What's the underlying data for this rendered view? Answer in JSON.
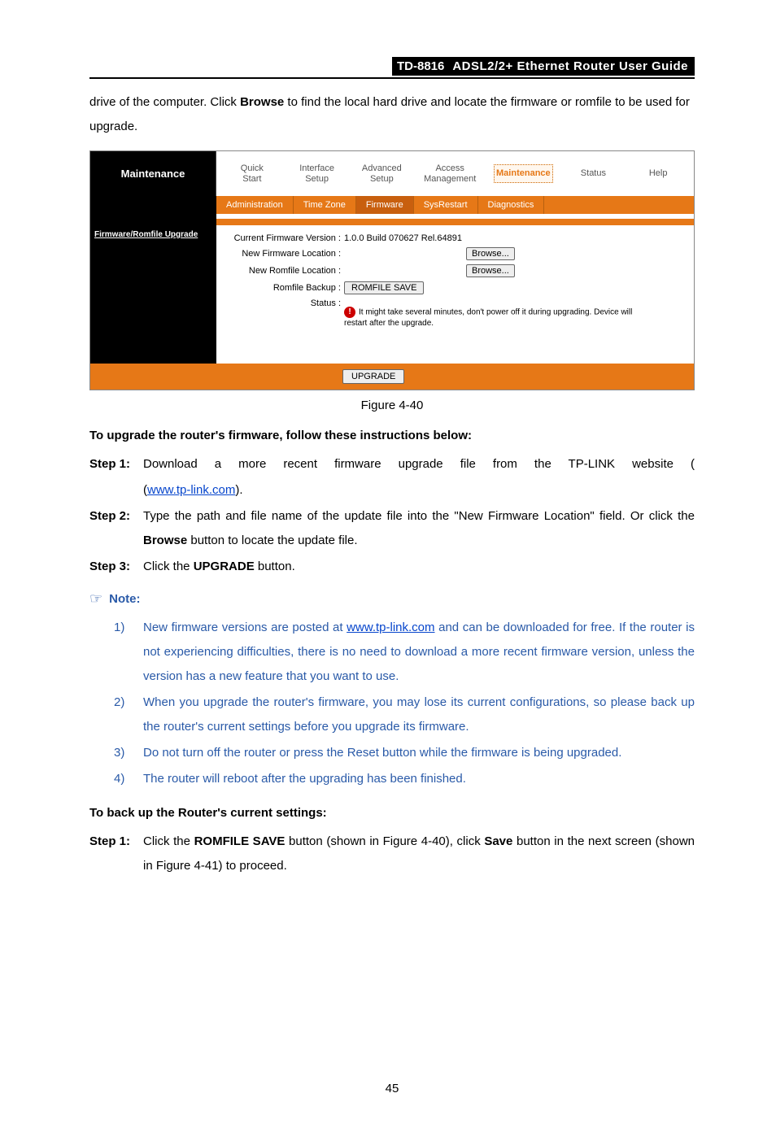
{
  "header": {
    "model": "TD-8816",
    "title": "ADSL2/2+ Ethernet Router User Guide"
  },
  "intro": {
    "text_before_browse": "drive of the computer. Click ",
    "browse": "Browse",
    "text_after_browse": " to find the local hard drive and locate the firmware or romfile to be used for upgrade."
  },
  "router_ui": {
    "sidebar_title": "Maintenance",
    "mainnav": [
      {
        "line1": "Quick",
        "line2": "Start"
      },
      {
        "line1": "Interface",
        "line2": "Setup"
      },
      {
        "line1": "Advanced",
        "line2": "Setup"
      },
      {
        "line1": "Access",
        "line2": "Management"
      },
      {
        "line1": "Maintenance",
        "line2": ""
      },
      {
        "line1": "Status",
        "line2": ""
      },
      {
        "line1": "Help",
        "line2": ""
      }
    ],
    "mainnav_active_index": 4,
    "subnav": [
      "Administration",
      "Time Zone",
      "Firmware",
      "SysRestart",
      "Diagnostics"
    ],
    "subnav_active_index": 2,
    "sidebar_link": "Firmware/Romfile Upgrade",
    "form": {
      "current_version_label": "Current Firmware Version :",
      "current_version_value": "1.0.0 Build 070627 Rel.64891",
      "new_firmware_label": "New Firmware Location :",
      "new_romfile_label": "New Romfile Location :",
      "romfile_backup_label": "Romfile Backup :",
      "browse_btn": "Browse...",
      "romfile_save_btn": "ROMFILE SAVE",
      "status_label": "Status :",
      "status_msg": "It might take several minutes, don't power off it during upgrading. Device will restart after the upgrade."
    },
    "upgrade_btn": "UPGRADE"
  },
  "figure_caption": "Figure 4-40",
  "section1_heading": "To upgrade the router's firmware, follow these instructions below:",
  "steps": [
    {
      "label": "Step 1:",
      "pre": "Download a more recent firmware upgrade file from the TP-LINK website (",
      "link": "www.tp-link.com",
      "post": ")."
    },
    {
      "label": "Step 2:",
      "body": "Type the path and file name of the update file into the \"New Firmware Location\" field. Or click the ",
      "bold": "Browse",
      "post": " button to locate the update file."
    },
    {
      "label": "Step 3:",
      "body": "Click the ",
      "bold": "UPGRADE",
      "post": " button."
    }
  ],
  "note_label": "Note:",
  "notes": [
    {
      "num": "1)",
      "pre": "New firmware versions are posted at ",
      "link": "www.tp-link.com",
      "post": " and can be downloaded for free. If the router is not experiencing difficulties, there is no need to download a more recent firmware version, unless the version has a new feature that you want to use."
    },
    {
      "num": "2)",
      "body": "When you upgrade the router's firmware, you may lose its current configurations, so please back up the router's current settings before you upgrade its firmware."
    },
    {
      "num": "3)",
      "body": "Do not turn off the router or press the Reset button while the firmware is being upgraded."
    },
    {
      "num": "4)",
      "body": "The router will reboot after the upgrading has been finished."
    }
  ],
  "section2_heading": "To back up the Router's current settings:",
  "backup_step": {
    "label": "Step 1:",
    "p1": "Click the ",
    "b1": "ROMFILE SAVE",
    "p2": " button (shown in Figure 4-40), click ",
    "b2": "Save",
    "p3": " button in the next screen (shown in Figure 4-41) to proceed."
  },
  "page_number": "45"
}
